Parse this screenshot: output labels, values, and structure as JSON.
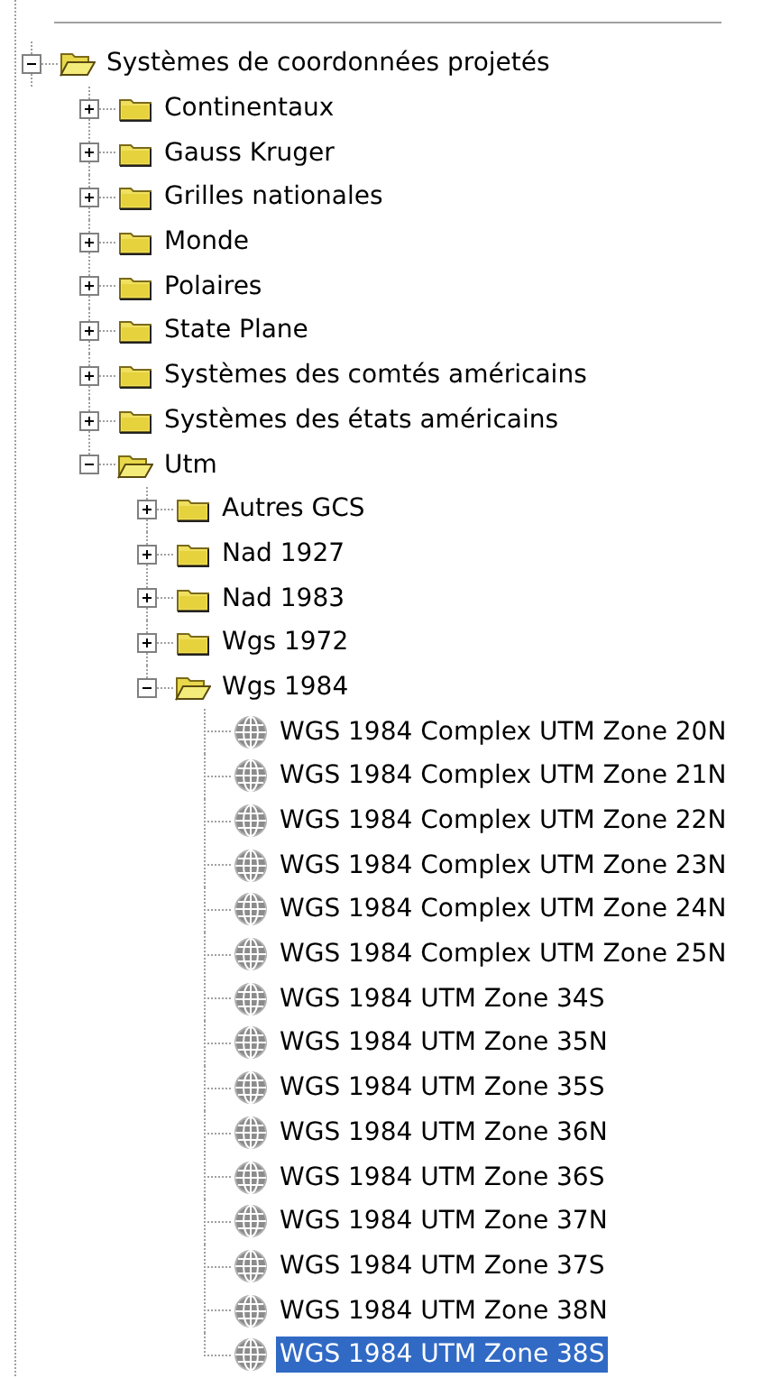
{
  "tree": {
    "items": [
      {
        "label": "Systèmes de coordonnées projetés",
        "kind": "folder",
        "expanded": true,
        "selected": false,
        "children": [
          {
            "label": "Continentaux",
            "kind": "folder",
            "expanded": false,
            "selected": false
          },
          {
            "label": "Gauss Kruger",
            "kind": "folder",
            "expanded": false,
            "selected": false
          },
          {
            "label": "Grilles nationales",
            "kind": "folder",
            "expanded": false,
            "selected": false
          },
          {
            "label": "Monde",
            "kind": "folder",
            "expanded": false,
            "selected": false
          },
          {
            "label": "Polaires",
            "kind": "folder",
            "expanded": false,
            "selected": false
          },
          {
            "label": "State Plane",
            "kind": "folder",
            "expanded": false,
            "selected": false
          },
          {
            "label": "Systèmes des comtés américains",
            "kind": "folder",
            "expanded": false,
            "selected": false
          },
          {
            "label": "Systèmes des états américains",
            "kind": "folder",
            "expanded": false,
            "selected": false
          },
          {
            "label": "Utm",
            "kind": "folder",
            "expanded": true,
            "selected": false,
            "children": [
              {
                "label": "Autres GCS",
                "kind": "folder",
                "expanded": false,
                "selected": false
              },
              {
                "label": "Nad 1927",
                "kind": "folder",
                "expanded": false,
                "selected": false
              },
              {
                "label": "Nad 1983",
                "kind": "folder",
                "expanded": false,
                "selected": false
              },
              {
                "label": "Wgs 1972",
                "kind": "folder",
                "expanded": false,
                "selected": false
              },
              {
                "label": "Wgs 1984",
                "kind": "folder",
                "expanded": true,
                "selected": false,
                "children": [
                  {
                    "label": "WGS 1984 Complex UTM Zone 20N",
                    "kind": "projection",
                    "selected": false
                  },
                  {
                    "label": "WGS 1984 Complex UTM Zone 21N",
                    "kind": "projection",
                    "selected": false
                  },
                  {
                    "label": "WGS 1984 Complex UTM Zone 22N",
                    "kind": "projection",
                    "selected": false
                  },
                  {
                    "label": "WGS 1984 Complex UTM Zone 23N",
                    "kind": "projection",
                    "selected": false
                  },
                  {
                    "label": "WGS 1984 Complex UTM Zone 24N",
                    "kind": "projection",
                    "selected": false
                  },
                  {
                    "label": "WGS 1984 Complex UTM Zone 25N",
                    "kind": "projection",
                    "selected": false
                  },
                  {
                    "label": "WGS 1984 UTM Zone 34S",
                    "kind": "projection",
                    "selected": false
                  },
                  {
                    "label": "WGS 1984 UTM Zone 35N",
                    "kind": "projection",
                    "selected": false
                  },
                  {
                    "label": "WGS 1984 UTM Zone 35S",
                    "kind": "projection",
                    "selected": false
                  },
                  {
                    "label": "WGS 1984 UTM Zone 36N",
                    "kind": "projection",
                    "selected": false
                  },
                  {
                    "label": "WGS 1984 UTM Zone 36S",
                    "kind": "projection",
                    "selected": false
                  },
                  {
                    "label": "WGS 1984 UTM Zone 37N",
                    "kind": "projection",
                    "selected": false
                  },
                  {
                    "label": "WGS 1984 UTM Zone 37S",
                    "kind": "projection",
                    "selected": false
                  },
                  {
                    "label": "WGS 1984 UTM Zone 38N",
                    "kind": "projection",
                    "selected": false
                  },
                  {
                    "label": "WGS 1984 UTM Zone 38S",
                    "kind": "projection",
                    "selected": true
                  }
                ]
              }
            ]
          }
        ]
      }
    ]
  }
}
